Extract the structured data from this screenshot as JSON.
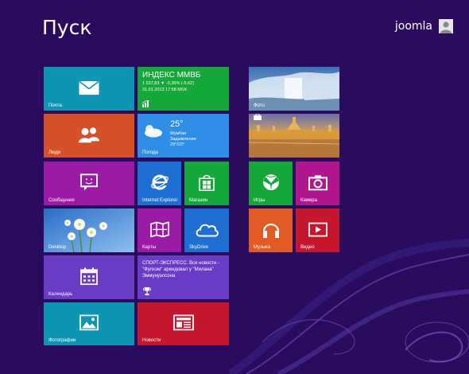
{
  "header": {
    "title": "Пуск",
    "user_name": "joomla"
  },
  "tiles": {
    "mail": {
      "label": "Почта",
      "color": "#0e95b4",
      "icon": "envelope-icon"
    },
    "finance": {
      "label": "",
      "color": "#15a73a",
      "icon": "chart-icon",
      "name": "ИНДЕКС ММВБ",
      "line1": "1 537,83  ▼  -0,36% (-5,62)",
      "line2": "31.01.2013 17:58 MSK"
    },
    "photos_app": {
      "label": "Фото",
      "color": "#8fb2d4",
      "icon": "photo-icon"
    },
    "people": {
      "label": "Люди",
      "color": "#d5512a",
      "icon": "people-icon"
    },
    "weather": {
      "label": "Погода",
      "color": "#2f8ee6",
      "icon": "cloud-sun-icon",
      "temp": "25°",
      "city": "Мумбаи",
      "condition": "Задымление",
      "range": "29°/22°"
    },
    "travel": {
      "label": "",
      "color": "#c99a4a",
      "icon": "suitcase-icon"
    },
    "messaging": {
      "label": "Сообщения",
      "color": "#9b1aa6",
      "icon": "chat-smiley-icon"
    },
    "ie": {
      "label": "Internet Explorer",
      "color": "#1f6fd2",
      "icon": "internet-explorer-icon"
    },
    "store": {
      "label": "Магазин",
      "color": "#15a73a",
      "icon": "store-bag-icon"
    },
    "games": {
      "label": "Игры",
      "color": "#15a73a",
      "icon": "xbox-controller-icon"
    },
    "camera": {
      "label": "Камера",
      "color": "#b0178f",
      "icon": "camera-icon"
    },
    "desktop": {
      "label": "Desktop",
      "color": "#4b8fd6",
      "icon": "desktop-flowers-icon"
    },
    "maps": {
      "label": "Карты",
      "color": "#9b1aa6",
      "icon": "map-icon"
    },
    "skydrive": {
      "label": "SkyDrive",
      "color": "#1f6fd2",
      "icon": "cloud-icon"
    },
    "music": {
      "label": "Музыка",
      "color": "#e35b24",
      "icon": "headphones-icon"
    },
    "video": {
      "label": "Видео",
      "color": "#c4162d",
      "icon": "play-icon"
    },
    "calendar": {
      "label": "Календарь",
      "color": "#6a3bc4",
      "icon": "calendar-icon"
    },
    "sport": {
      "label": "",
      "color": "#6a3bc4",
      "icon": "trophy-icon",
      "text": "СПОРТ-ЭКСПРЕСС. Все новости - \"Фулхэм\" арендовал у \"Милана\" Эммунуэлсона"
    },
    "photos": {
      "label": "Фотографии",
      "color": "#0e95b4",
      "icon": "picture-icon"
    },
    "news": {
      "label": "Новости",
      "color": "#c4162d",
      "icon": "newspaper-icon"
    }
  }
}
